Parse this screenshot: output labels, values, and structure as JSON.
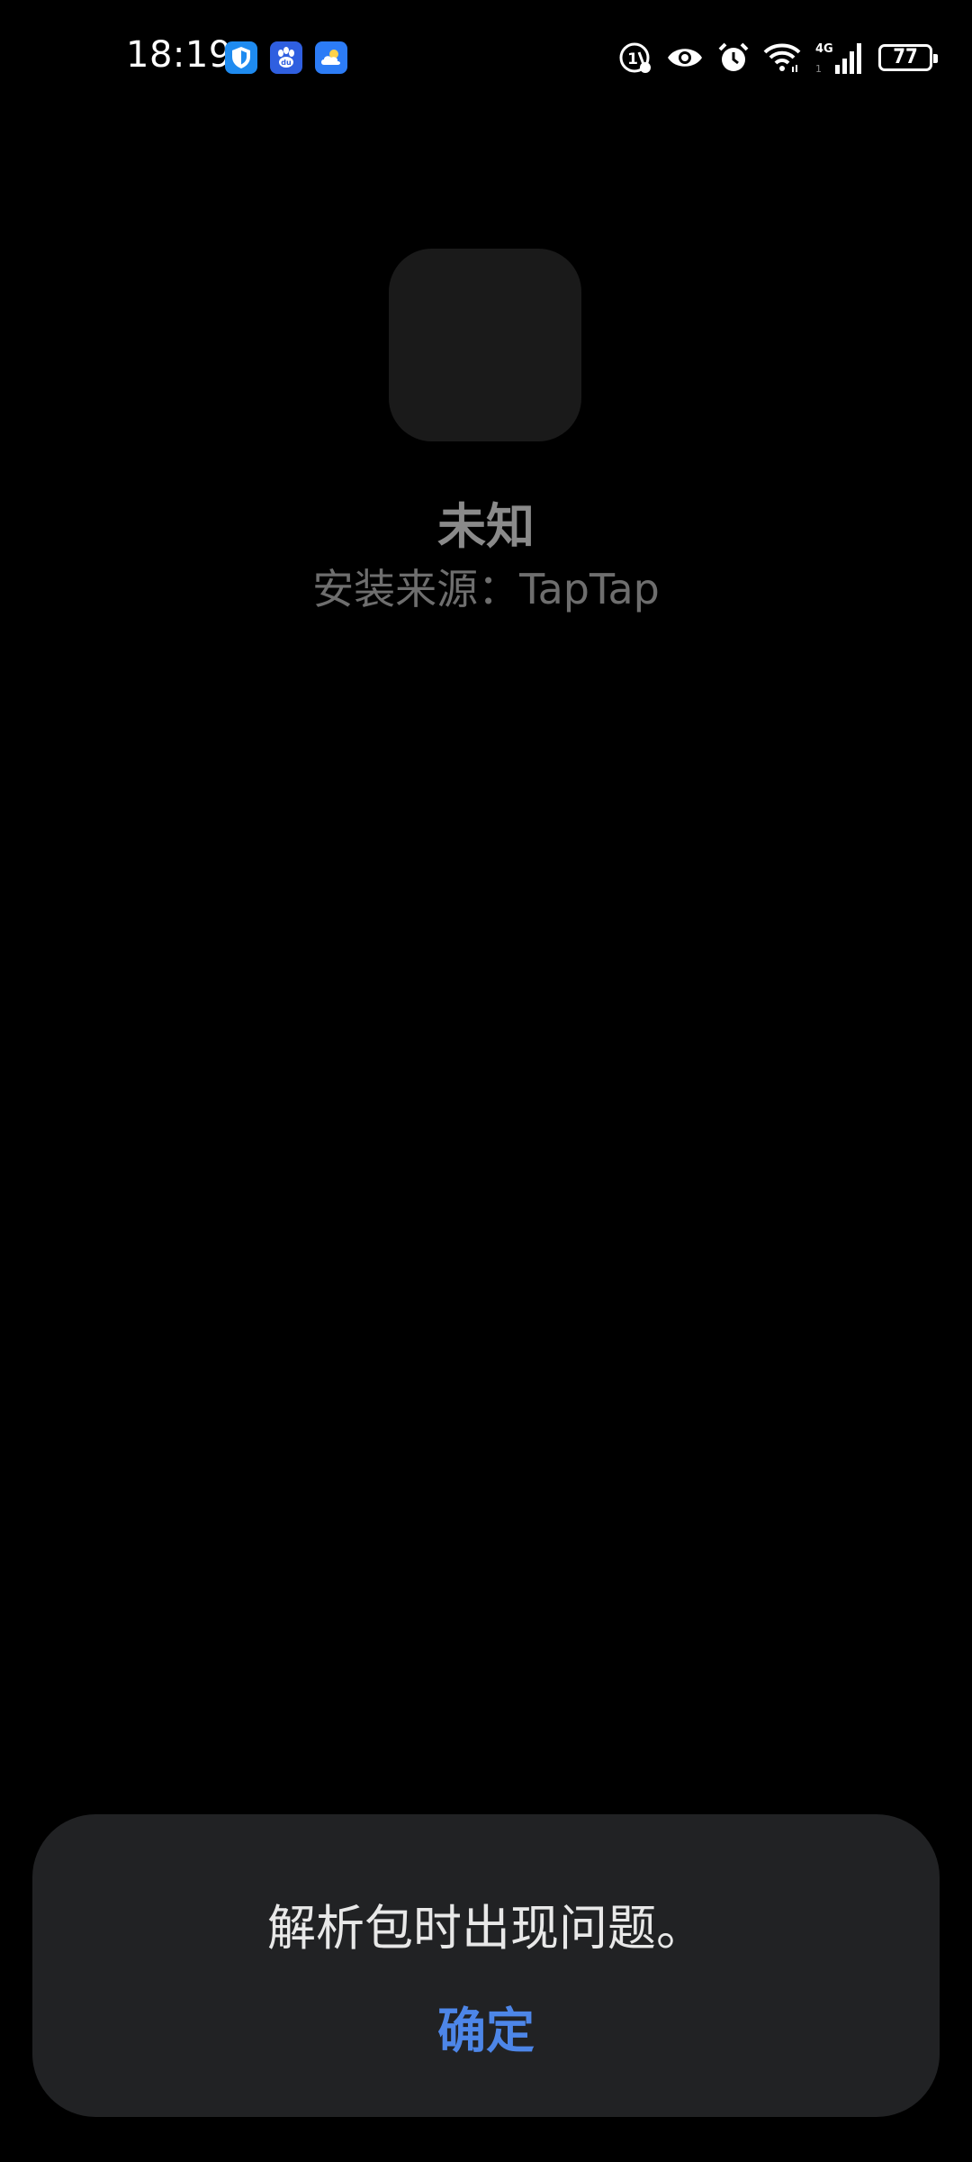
{
  "status_bar": {
    "time": "18:19",
    "notification_icons": [
      "shield-app-icon",
      "baidu-app-icon",
      "weather-app-icon"
    ],
    "system_icons": [
      "data-saver-icon",
      "eye-comfort-icon",
      "alarm-icon",
      "wifi-icon",
      "mobile-signal-4g-icon"
    ],
    "network_label": "4G",
    "battery_level": "77"
  },
  "app_info": {
    "icon": "app-icon-placeholder",
    "name": "未知",
    "install_source": "安装来源：TapTap"
  },
  "dialog": {
    "message": "解析包时出现问题。",
    "confirm_label": "确定"
  },
  "colors": {
    "background": "#000000",
    "dialog_background": "#212224",
    "accent": "#4d86e8",
    "app_name_text": "#8a8a8a",
    "secondary_text": "#6e6e6e"
  }
}
